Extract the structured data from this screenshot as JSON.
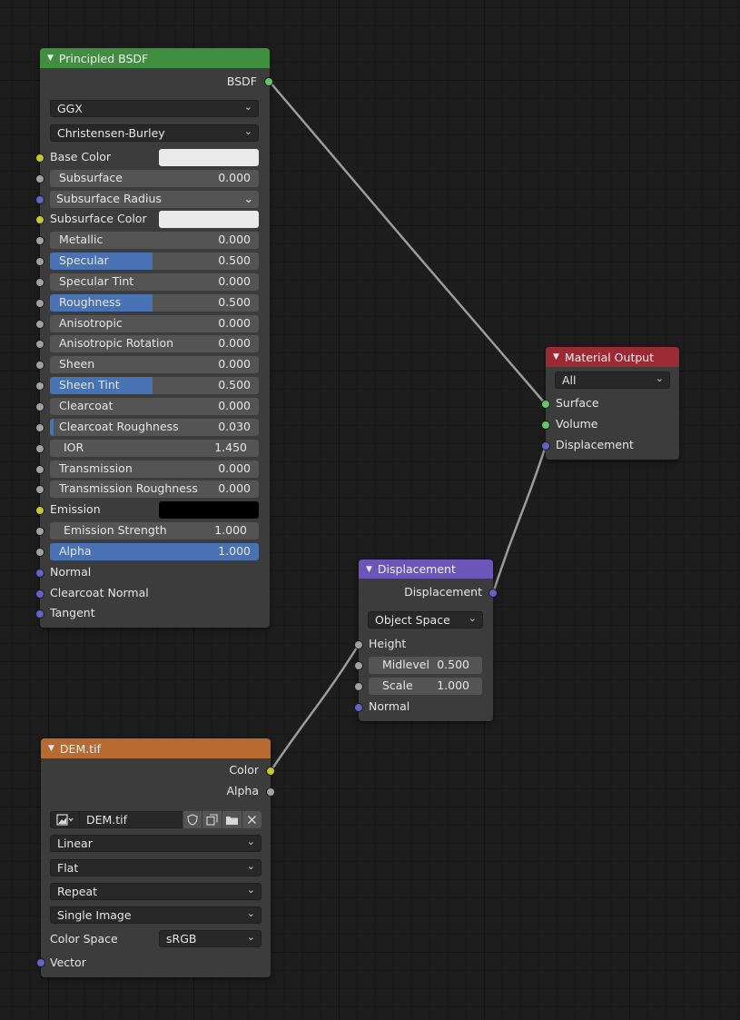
{
  "principled": {
    "title": "Principled BSDF",
    "output": "BSDF",
    "distribution": "GGX",
    "subsurface_method": "Christensen-Burley",
    "base_color_label": "Base Color",
    "subsurface": {
      "label": "Subsurface",
      "value": "0.000"
    },
    "subsurface_radius": "Subsurface Radius",
    "subsurface_color_label": "Subsurface Color",
    "metallic": {
      "label": "Metallic",
      "value": "0.000"
    },
    "specular": {
      "label": "Specular",
      "value": "0.500"
    },
    "specular_tint": {
      "label": "Specular Tint",
      "value": "0.000"
    },
    "roughness": {
      "label": "Roughness",
      "value": "0.500"
    },
    "anisotropic": {
      "label": "Anisotropic",
      "value": "0.000"
    },
    "anisotropic_rotation": {
      "label": "Anisotropic Rotation",
      "value": "0.000"
    },
    "sheen": {
      "label": "Sheen",
      "value": "0.000"
    },
    "sheen_tint": {
      "label": "Sheen Tint",
      "value": "0.500"
    },
    "clearcoat": {
      "label": "Clearcoat",
      "value": "0.000"
    },
    "clearcoat_roughness": {
      "label": "Clearcoat Roughness",
      "value": "0.030"
    },
    "ior": {
      "label": "IOR",
      "value": "1.450"
    },
    "transmission": {
      "label": "Transmission",
      "value": "0.000"
    },
    "transmission_roughness": {
      "label": "Transmission Roughness",
      "value": "0.000"
    },
    "emission_label": "Emission",
    "emission_strength": {
      "label": "Emission Strength",
      "value": "1.000"
    },
    "alpha": {
      "label": "Alpha",
      "value": "1.000"
    },
    "normal": "Normal",
    "clearcoat_normal": "Clearcoat Normal",
    "tangent": "Tangent"
  },
  "material_output": {
    "title": "Material Output",
    "target": "All",
    "surface": "Surface",
    "volume": "Volume",
    "displacement": "Displacement"
  },
  "displacement_node": {
    "title": "Displacement",
    "output": "Displacement",
    "space": "Object Space",
    "height": "Height",
    "midlevel": {
      "label": "Midlevel",
      "value": "0.500"
    },
    "scale": {
      "label": "Scale",
      "value": "1.000"
    },
    "normal": "Normal"
  },
  "image_node": {
    "title": "DEM.tif",
    "out_color": "Color",
    "out_alpha": "Alpha",
    "image_name": "DEM.tif",
    "interpolation": "Linear",
    "projection": "Flat",
    "extension": "Repeat",
    "source": "Single Image",
    "color_space_label": "Color Space",
    "color_space": "sRGB",
    "vector": "Vector"
  },
  "colors": {
    "principled_header": "#3f8f3f",
    "output_header": "#9b2a35",
    "displacement_header": "#6a55b8",
    "image_header": "#b86b30",
    "base_color": "#eaeaea",
    "subsurface_color": "#eaeaea",
    "emission_color": "#000000",
    "slider_fill": "#4772b3"
  },
  "icons": [
    "collapse-triangle-icon",
    "image-type-icon",
    "fake-user-shield-icon",
    "duplicate-icon",
    "open-folder-icon",
    "unlink-x-icon",
    "chevron-down-icon"
  ]
}
